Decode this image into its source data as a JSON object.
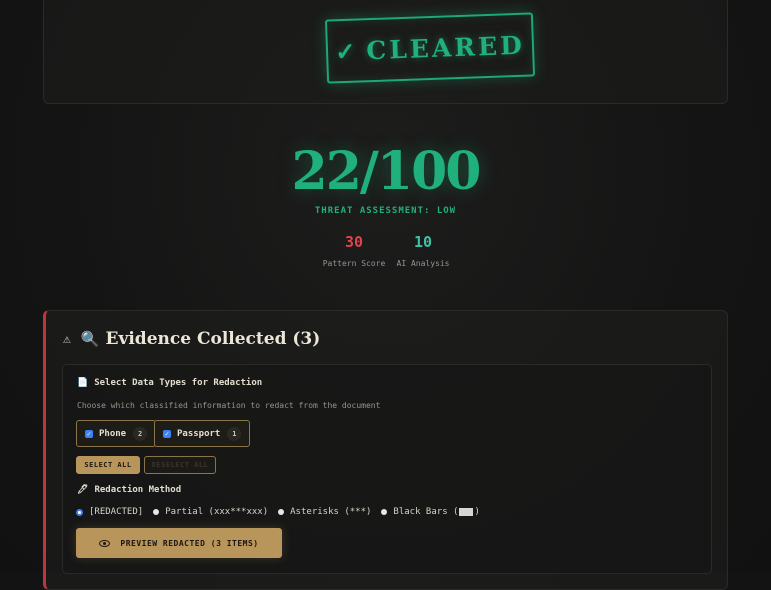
{
  "stamp": {
    "check": "✓",
    "label": "CLEARED",
    "color": "#1fb07c"
  },
  "score": {
    "value": "22/100",
    "threat": "THREAT ASSESSMENT: LOW"
  },
  "metrics": [
    {
      "value": "30",
      "label": "Pattern Score",
      "color": "#e0444d"
    },
    {
      "value": "10",
      "label": "AI Analysis",
      "color": "#3fc1a8"
    }
  ],
  "evidence": {
    "warning_icon": "⚠",
    "search_icon": "🔍",
    "title": "Evidence Collected (3)",
    "select": {
      "icon": "📄",
      "title": "Select Data Types for Redaction",
      "help": "Choose which classified information to redact from the document",
      "chips": [
        {
          "label": "Phone",
          "count": "2",
          "checked": true
        },
        {
          "label": "Passport",
          "count": "1",
          "checked": true
        }
      ],
      "select_all": "SELECT ALL",
      "deselect_all": "DESELECT ALL"
    },
    "method": {
      "icon": "🖊",
      "title": "Redaction Method",
      "options": [
        {
          "label": "[REDACTED]",
          "selected": true
        },
        {
          "label": "Partial (xxx***xxx)",
          "selected": false
        },
        {
          "label": "Asterisks (***)",
          "selected": false
        },
        {
          "label": "Black Bars (",
          "suffix": ")",
          "selected": false
        }
      ]
    },
    "preview_button": "PREVIEW REDACTED (3 ITEMS)"
  }
}
